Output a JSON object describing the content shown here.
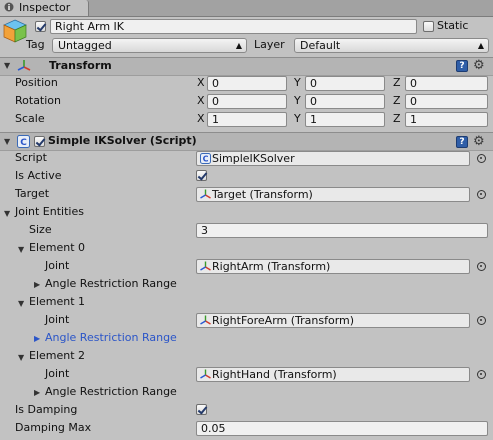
{
  "window": {
    "tab_title": "Inspector"
  },
  "game_object": {
    "active": true,
    "name": "Right Arm IK",
    "static_label": "Static",
    "static": false,
    "tag_label": "Tag",
    "tag_value": "Untagged",
    "layer_label": "Layer",
    "layer_value": "Default"
  },
  "transform": {
    "title": "Transform",
    "rows": [
      {
        "label": "Position",
        "x": "0",
        "y": "0",
        "z": "0"
      },
      {
        "label": "Rotation",
        "x": "0",
        "y": "0",
        "z": "0"
      },
      {
        "label": "Scale",
        "x": "1",
        "y": "1",
        "z": "1"
      }
    ],
    "axis_x": "X",
    "axis_y": "Y",
    "axis_z": "Z"
  },
  "solver": {
    "enabled": true,
    "title": "Simple IKSolver (Script)",
    "script_label": "Script",
    "script_value": "SimpleIKSolver",
    "is_active_label": "Is Active",
    "is_active": true,
    "target_label": "Target",
    "target_value": "Target (Transform)",
    "joint_entities_label": "Joint Entities",
    "size_label": "Size",
    "size_value": "3",
    "elements": [
      {
        "label": "Element 0",
        "joint_label": "Joint",
        "joint_value": "RightArm (Transform)",
        "range_label": "Angle Restriction Range"
      },
      {
        "label": "Element 1",
        "joint_label": "Joint",
        "joint_value": "RightForeArm (Transform)",
        "range_label": "Angle Restriction Range"
      },
      {
        "label": "Element 2",
        "joint_label": "Joint",
        "joint_value": "RightHand (Transform)",
        "range_label": "Angle Restriction Range"
      }
    ],
    "is_damping_label": "Is Damping",
    "is_damping": true,
    "damping_max_label": "Damping Max",
    "damping_max_value": "0.05"
  },
  "icons": {
    "tab": "inspector-info-icon",
    "gameobject": "cube-icon",
    "transform": "transform-axes-icon",
    "script": "csharp-script-icon",
    "help": "help-book-icon",
    "settings": "gear-icon",
    "object_picker": "object-picker-icon"
  },
  "colors": {
    "background": "#c2c2c2",
    "component_header": "#b4b4b4",
    "selected_foldout": "#2b55c8"
  }
}
